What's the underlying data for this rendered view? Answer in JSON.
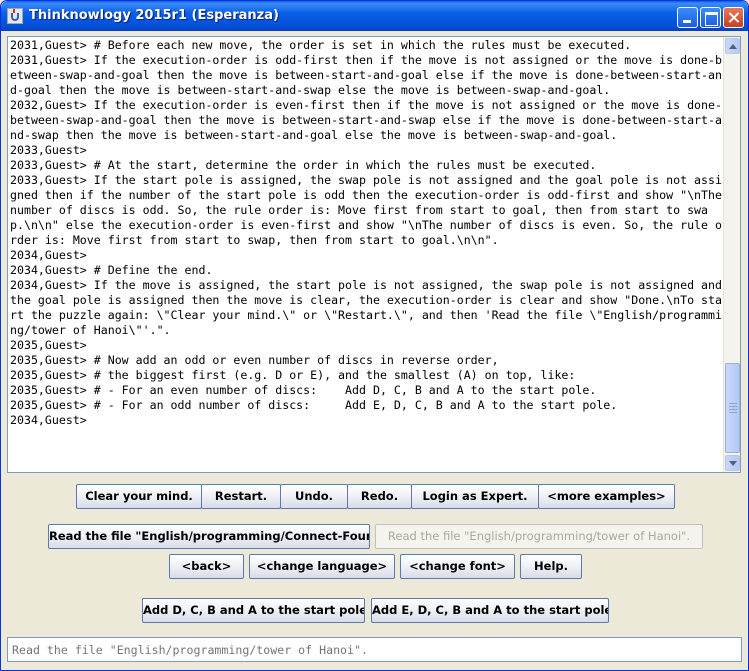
{
  "window": {
    "title": "Thinknowlogy 2015r1 (Esperanza)"
  },
  "console": {
    "text": "2031,Guest> # Before each new move, the order is set in which the rules must be executed.\n2031,Guest> If the execution-order is odd-first then if the move is not assigned or the move is done-between-swap-and-goal then the move is between-start-and-goal else if the move is done-between-start-and-goal then the move is between-start-and-swap else the move is between-swap-and-goal.\n2032,Guest> If the execution-order is even-first then if the move is not assigned or the move is done-between-swap-and-goal then the move is between-start-and-swap else if the move is done-between-start-and-swap then the move is between-start-and-goal else the move is between-swap-and-goal.\n2033,Guest>\n2033,Guest> # At the start, determine the order in which the rules must be executed.\n2033,Guest> If the start pole is assigned, the swap pole is not assigned and the goal pole is not assigned then if the number of the start pole is odd then the execution-order is odd-first and show \"\\nThe number of discs is odd. So, the rule order is: Move first from start to goal, then from start to swap.\\n\\n\" else the execution-order is even-first and show \"\\nThe number of discs is even. So, the rule order is: Move first from start to swap, then from start to goal.\\n\\n\".\n2034,Guest>\n2034,Guest> # Define the end.\n2034,Guest> If the move is assigned, the start pole is not assigned, the swap pole is not assigned and the goal pole is assigned then the move is clear, the execution-order is clear and show \"Done.\\nTo start the puzzle again: \\\"Clear your mind.\\\" or \\\"Restart.\\\", and then 'Read the file \\\"English/programming/tower of Hanoi\\\"'.\".\n2035,Guest>\n2035,Guest> # Now add an odd or even number of discs in reverse order,\n2035,Guest> # the biggest first (e.g. D or E), and the smallest (A) on top, like:\n2035,Guest> # - For an even number of discs:    Add D, C, B and A to the start pole.\n2035,Guest> # - For an odd number of discs:     Add E, D, C, B and A to the start pole.\n2034,Guest>"
  },
  "toolbar_row1": {
    "clear": "Clear your mind.",
    "restart": "Restart.",
    "undo": "Undo.",
    "redo": "Redo.",
    "login": "Login as Expert.",
    "more": "<more examples>"
  },
  "toolbar_row2": {
    "read_connect_four": "Read the file \"English/programming/Connect-Four\".",
    "read_hanoi": "Read the file \"English/programming/tower of Hanoi\"."
  },
  "toolbar_row3": {
    "back": "<back>",
    "change_language": "<change language>",
    "change_font": "<change font>",
    "help": "Help."
  },
  "toolbar_row4": {
    "add_even": "Add D, C, B and A to the start pole.",
    "add_odd": "Add E, D, C, B and A to the start pole."
  },
  "input": {
    "placeholder": "Read the file \"English/programming/tower of Hanoi\"."
  }
}
